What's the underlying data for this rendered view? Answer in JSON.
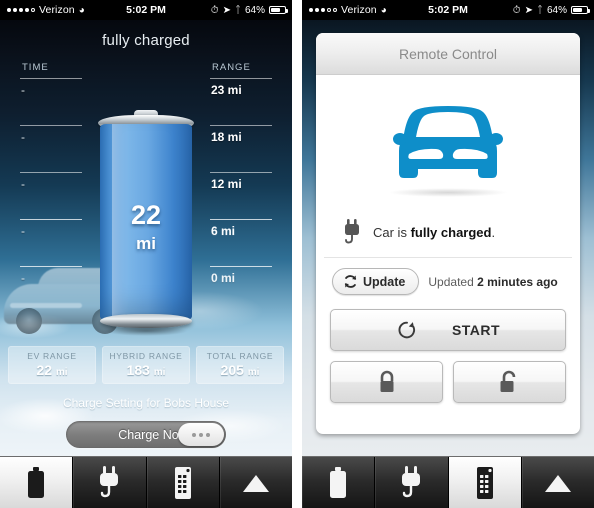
{
  "status_bar": {
    "carrier": "Verizon",
    "signal_dots_filled": 4,
    "signal_dots_total": 5,
    "wifi_icon": "wifi-icon",
    "time": "5:02 PM",
    "location_icon": "location-arrow-icon",
    "alarm_icon": "alarm-icon",
    "bluetooth_icon": "bluetooth-icon",
    "battery_percent": "64%"
  },
  "left_screen": {
    "title": "fully charged",
    "columns": {
      "time_header": "TIME",
      "range_header": "RANGE"
    },
    "rows": [
      {
        "time": "-",
        "range": "23 mi"
      },
      {
        "time": "-",
        "range": "18 mi"
      },
      {
        "time": "-",
        "range": "12 mi"
      },
      {
        "time": "-",
        "range": "6 mi"
      },
      {
        "time": "-",
        "range": "0 mi"
      }
    ],
    "battery": {
      "value": "22",
      "unit": "mi",
      "fill_color": "#4b93d8"
    },
    "range_cards": [
      {
        "title": "EV RANGE",
        "value": "22",
        "unit": "mi"
      },
      {
        "title": "HYBRID RANGE",
        "value": "183",
        "unit": "mi"
      },
      {
        "title": "TOTAL RANGE",
        "value": "205",
        "unit": "mi"
      }
    ],
    "charge_setting_label": "Charge Setting for Bobs House",
    "charge_toggle_label": "Charge Now",
    "ghost_car_icon": "car-photo"
  },
  "right_screen": {
    "header_title": "Remote Control",
    "car_icon": "car-front-icon",
    "car_icon_color": "#0e8ec9",
    "plug_icon": "plug-icon",
    "status_prefix": "Car is ",
    "status_emphasis": "fully charged",
    "status_suffix": ".",
    "update_button_label": "Update",
    "update_icon": "refresh-icon",
    "updated_prefix": "Updated ",
    "updated_emphasis": "2 minutes ago",
    "start_button_label": "START",
    "start_icon": "ignition-icon",
    "lock_button_icon": "lock-closed-icon",
    "unlock_button_icon": "lock-open-icon"
  },
  "tab_bar": {
    "tabs": [
      {
        "icon": "battery-icon",
        "name": "battery"
      },
      {
        "icon": "plug-icon",
        "name": "charging"
      },
      {
        "icon": "remote-icon",
        "name": "remote-control"
      },
      {
        "icon": "triangle-icon",
        "name": "more"
      }
    ],
    "left_active_index": 0,
    "right_active_index": 2
  }
}
